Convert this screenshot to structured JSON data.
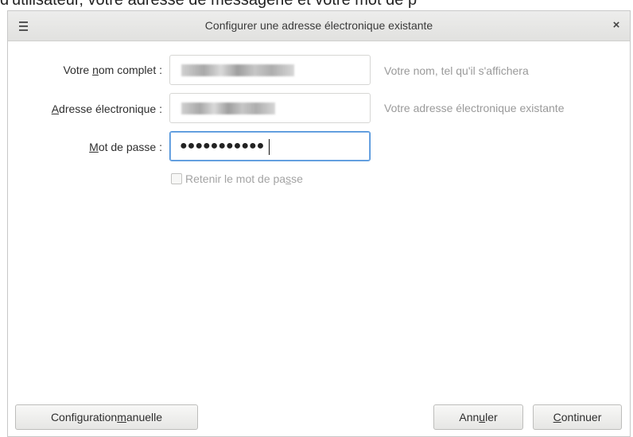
{
  "page_caption": "d'utilisateur, votre adresse de messagerie et votre mot de p",
  "window": {
    "title": "Configurer une adresse électronique existante",
    "close_glyph": "×"
  },
  "form": {
    "name": {
      "label_pre": "Votre ",
      "label_u": "n",
      "label_post": "om complet :",
      "hint": "Votre nom, tel qu'il s'affichera"
    },
    "email": {
      "label_pre": "",
      "label_u": "A",
      "label_post": "dresse électronique :",
      "hint": "Votre adresse électronique existante"
    },
    "password": {
      "label_pre": "",
      "label_u": "M",
      "label_post": "ot de passe :",
      "value_masked": "●●●●●●●●●●●"
    },
    "remember": {
      "label_pre": "Retenir le mot de pa",
      "label_u": "s",
      "label_post": "se",
      "checked": false
    }
  },
  "buttons": {
    "manual": {
      "pre": "Configuration ",
      "u": "m",
      "post": "anuelle"
    },
    "cancel": {
      "pre": "Ann",
      "u": "u",
      "post": "ler"
    },
    "continue": {
      "pre": "",
      "u": "C",
      "post": "ontinuer"
    }
  },
  "colors": {
    "focus_border": "#4a90d9",
    "hint_text": "#9a9a9a",
    "disabled_text": "#a3a3a3"
  }
}
